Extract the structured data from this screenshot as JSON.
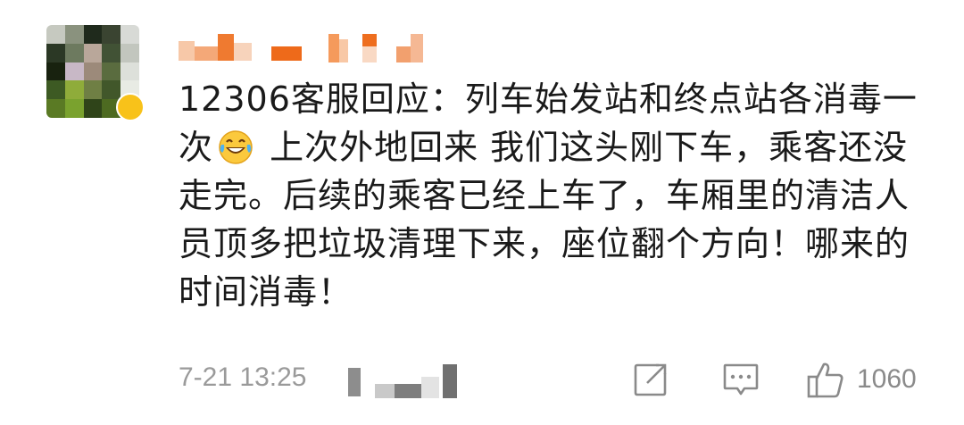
{
  "comment": {
    "author_avatar": "pixelated-avatar",
    "author_name_redacted": true,
    "text_part1": "12306客服回应：列车始发站和终点站各消毒一次",
    "emoji": "laughing-with-tears-emoji",
    "text_part2": " 上次外地回来 我们这头刚下车，乘客还没走完。后续的乘客已经上车了，车厢里的清洁人员顶多把垃圾清理下来，座位翻个方向！哪来的时间消毒！"
  },
  "footer": {
    "timestamp": "7-21 13:25",
    "source_redacted": true,
    "actions": {
      "repost_icon": "share-icon",
      "comment_icon": "comment-icon",
      "like_icon": "thumbs-up-icon",
      "like_count": "1060"
    }
  },
  "colors": {
    "text": "#1a1a1a",
    "meta": "#9a9a9a",
    "icon": "#8a8a8a",
    "badge": "#f8c21a"
  }
}
